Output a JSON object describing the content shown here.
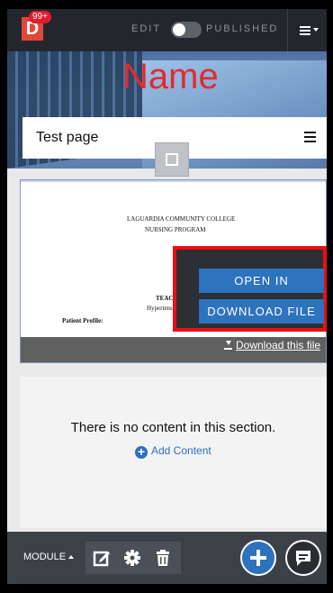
{
  "topbar": {
    "logo": "D",
    "notification_count": "99+",
    "edit_label": "EDIT",
    "published_label": "PUBLISHED"
  },
  "header": {
    "site_name": "Name",
    "page_title": "Test page"
  },
  "document": {
    "line_college": "LAGUARDIA COMMUNITY COLLEGE",
    "line_program": "NURSING PROGRAM",
    "line_teaching": "TEACHIN",
    "line_subtitle": "Hypertension m",
    "line_profile": "Patient Profile:",
    "download_link": "Download this file"
  },
  "popup": {
    "open_in_browser": "OPEN IN BROWSER",
    "download_file": "DOWNLOAD FILE"
  },
  "section": {
    "empty_message": "There is no content in this section.",
    "add_content": "Add Content"
  },
  "bottombar": {
    "module_label": "MODULE"
  },
  "colors": {
    "topbar": "#23272d",
    "accent_blue": "#2d73bd",
    "site_name_red": "#e3292e",
    "highlight_red": "#ea0f17",
    "toolbar": "#3b4147"
  },
  "icons": [
    "menu-icon",
    "expand-icon",
    "download-icon",
    "plus-circle-icon",
    "edit-icon",
    "gear-icon",
    "trash-icon",
    "plus-icon",
    "chat-icon"
  ]
}
